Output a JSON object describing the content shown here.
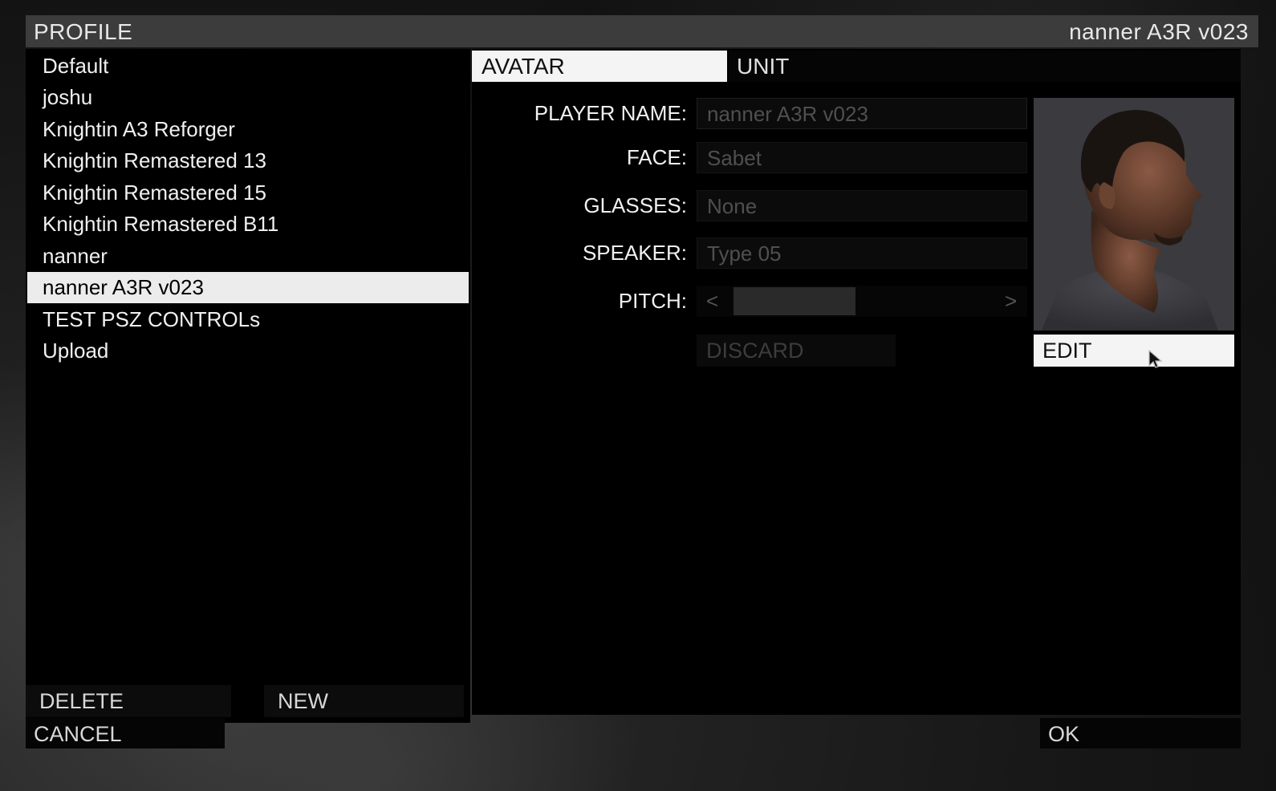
{
  "title": {
    "left": "PROFILE",
    "right": "nanner A3R v023"
  },
  "profiles": [
    {
      "name": "Default",
      "selected": false
    },
    {
      "name": "joshu",
      "selected": false
    },
    {
      "name": "Knightin A3 Reforger",
      "selected": false
    },
    {
      "name": "Knightin Remastered 13",
      "selected": false
    },
    {
      "name": "Knightin Remastered 15",
      "selected": false
    },
    {
      "name": "Knightin Remastered B11",
      "selected": false
    },
    {
      "name": "nanner",
      "selected": false
    },
    {
      "name": "nanner A3R v023",
      "selected": true
    },
    {
      "name": "TEST PSZ CONTROLs",
      "selected": false
    },
    {
      "name": "Upload",
      "selected": false
    }
  ],
  "left_buttons": {
    "delete": "DELETE",
    "new": "NEW"
  },
  "tabs": {
    "avatar": "AVATAR",
    "unit": "UNIT",
    "active": "avatar"
  },
  "fields": {
    "player_name": {
      "label": "PLAYER NAME:",
      "value": "nanner A3R v023"
    },
    "face": {
      "label": "FACE:",
      "value": "Sabet"
    },
    "glasses": {
      "label": "GLASSES:",
      "value": "None"
    },
    "speaker": {
      "label": "SPEAKER:",
      "value": "Type 05"
    },
    "pitch": {
      "label": "PITCH:",
      "left_arrow": "<",
      "right_arrow": ">"
    }
  },
  "buttons": {
    "discard": "DISCARD",
    "edit": "EDIT",
    "cancel": "CANCEL",
    "ok": "OK"
  },
  "icons": {
    "portrait": "head-profile-portrait",
    "cursor": "mouse-pointer-icon"
  },
  "colors": {
    "panel": "#000000",
    "titlebar": "#3c3c3c",
    "selected": "#ececec",
    "disabled_text": "#4f4f4f"
  }
}
